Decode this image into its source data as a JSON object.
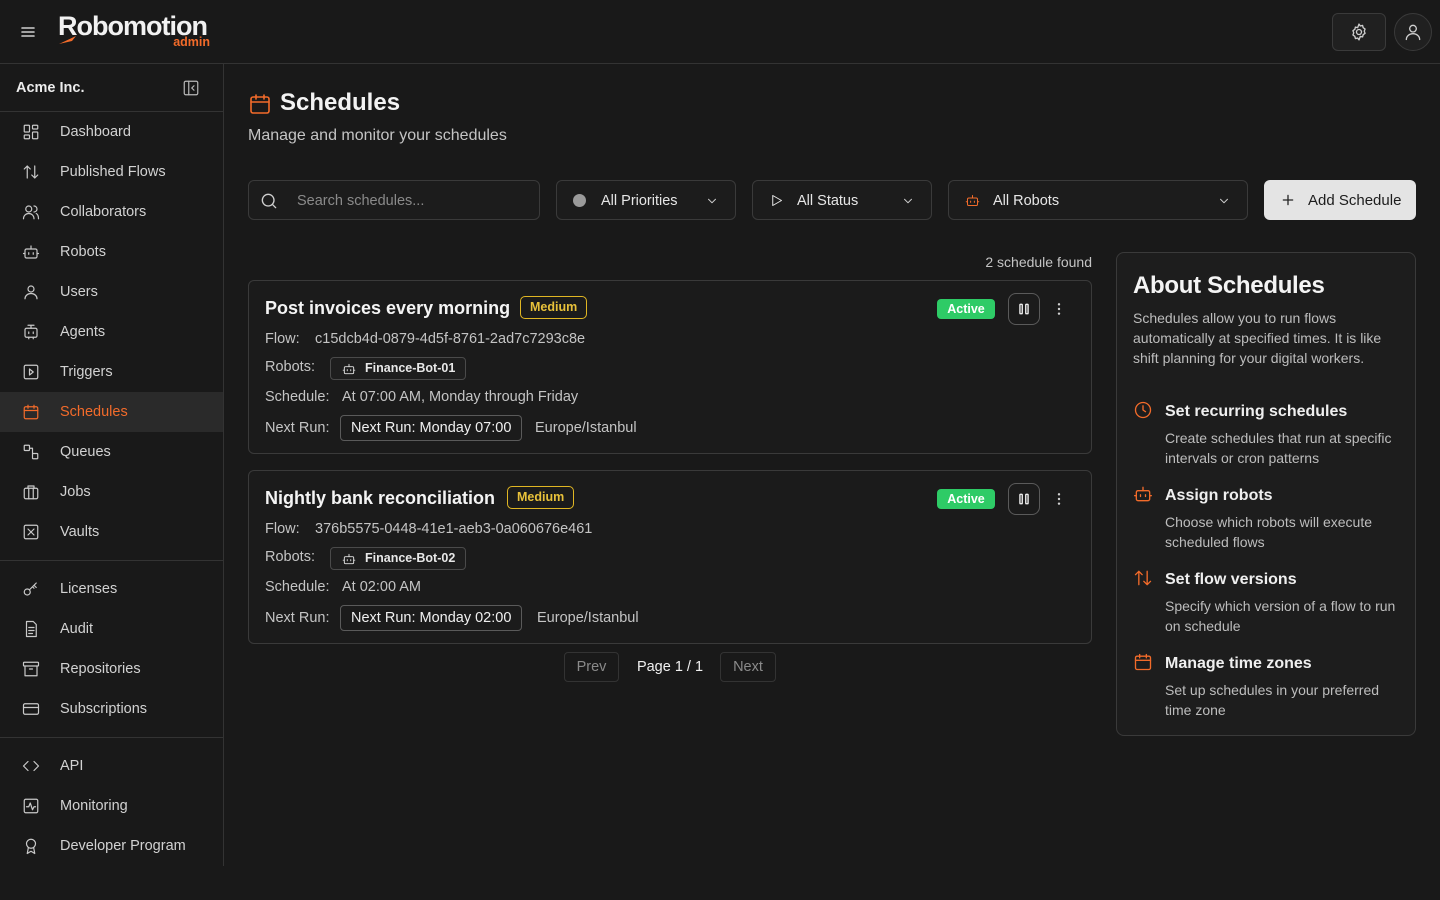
{
  "brand": {
    "name": "Robomotion",
    "sub": "admin",
    "accent": "#f26b2a"
  },
  "sidebar": {
    "org": "Acme Inc.",
    "items": [
      {
        "label": "Dashboard",
        "icon": "dashboard-icon"
      },
      {
        "label": "Published Flows",
        "icon": "arrows-up-down-icon"
      },
      {
        "label": "Collaborators",
        "icon": "users-icon"
      },
      {
        "label": "Robots",
        "icon": "robot-icon"
      },
      {
        "label": "Users",
        "icon": "user-icon"
      },
      {
        "label": "Agents",
        "icon": "agent-icon"
      },
      {
        "label": "Triggers",
        "icon": "trigger-icon"
      },
      {
        "label": "Schedules",
        "icon": "calendar-icon",
        "active": true
      },
      {
        "label": "Queues",
        "icon": "queues-icon"
      },
      {
        "label": "Jobs",
        "icon": "jobs-icon"
      },
      {
        "label": "Vaults",
        "icon": "vault-icon"
      }
    ],
    "items2": [
      {
        "label": "Licenses",
        "icon": "key-icon"
      },
      {
        "label": "Audit",
        "icon": "audit-icon"
      },
      {
        "label": "Repositories",
        "icon": "archive-icon"
      },
      {
        "label": "Subscriptions",
        "icon": "credit-card-icon"
      }
    ],
    "items3": [
      {
        "label": "API",
        "icon": "code-icon"
      },
      {
        "label": "Monitoring",
        "icon": "monitoring-icon"
      },
      {
        "label": "Developer Program",
        "icon": "award-icon"
      }
    ]
  },
  "page": {
    "title": "Schedules",
    "subtitle": "Manage and monitor your schedules"
  },
  "filters": {
    "search_placeholder": "Search schedules...",
    "priority": "All Priorities",
    "status": "All Status",
    "robots": "All Robots",
    "add_label": "Add Schedule"
  },
  "found": "2 schedule found",
  "labels": {
    "flow": "Flow:",
    "robots": "Robots:",
    "schedule": "Schedule:",
    "next_run": "Next Run:"
  },
  "schedules": [
    {
      "title": "Post invoices every morning",
      "priority": "Medium",
      "status": "Active",
      "flow": "c15dcb4d-0879-4d5f-8761-2ad7c7293c8e",
      "robot": "Finance-Bot-01",
      "schedule": "At 07:00 AM, Monday through Friday",
      "next_run": "Next Run: Monday 07:00",
      "timezone": "Europe/Istanbul"
    },
    {
      "title": "Nightly bank reconciliation",
      "priority": "Medium",
      "status": "Active",
      "flow": "376b5575-0448-41e1-aeb3-0a060676e461",
      "robot": "Finance-Bot-02",
      "schedule": "At 02:00 AM",
      "next_run": "Next Run: Monday 02:00",
      "timezone": "Europe/Istanbul"
    }
  ],
  "pagination": {
    "prev": "Prev",
    "label": "Page 1 / 1",
    "next": "Next"
  },
  "about": {
    "title": "About Schedules",
    "description": "Schedules allow you to run flows automatically at specified times. It is like shift planning for your digital workers.",
    "features": [
      {
        "title": "Set recurring schedules",
        "desc": "Create schedules that run at specific intervals or cron patterns",
        "icon": "clock-icon"
      },
      {
        "title": "Assign robots",
        "desc": "Choose which robots will execute scheduled flows",
        "icon": "robot-icon"
      },
      {
        "title": "Set flow versions",
        "desc": "Specify which version of a flow to run on schedule",
        "icon": "arrows-up-down-icon"
      },
      {
        "title": "Manage time zones",
        "desc": "Set up schedules in your preferred time zone",
        "icon": "calendar-icon"
      }
    ]
  }
}
